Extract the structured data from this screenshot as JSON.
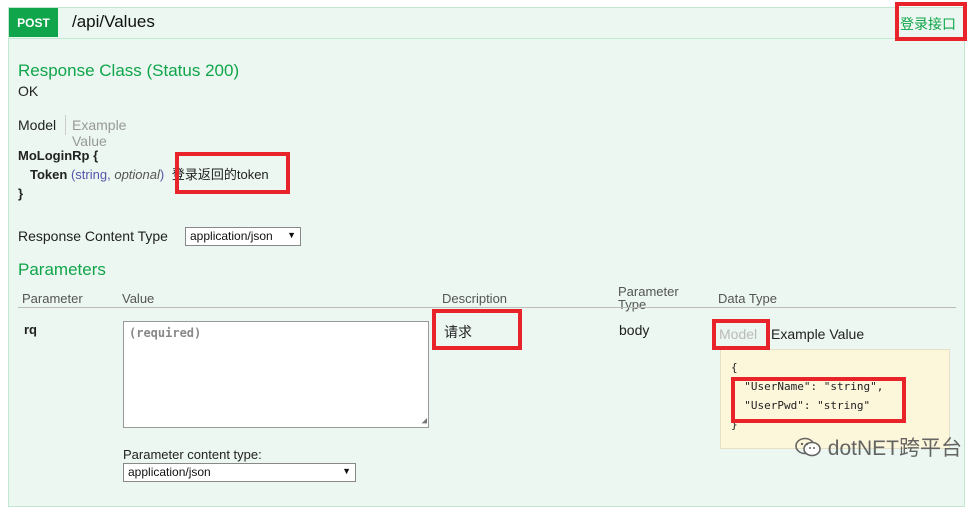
{
  "operation": {
    "method": "POST",
    "path": "/api/Values",
    "summary": "登录接口"
  },
  "response_class": {
    "heading": "Response Class (Status 200)",
    "status_text": "OK",
    "tabs": {
      "model": "Model",
      "example": "Example Value"
    },
    "model": {
      "name": "MoLoginRp",
      "open_brace": "{",
      "close_brace": "}",
      "property": {
        "name": "Token",
        "type_open": "(",
        "type": "string",
        "separator": ",",
        "optional": "optional",
        "type_close": ")",
        "description": "登录返回的token"
      }
    }
  },
  "response_content_type": {
    "label": "Response Content Type",
    "selected": "application/json"
  },
  "parameters": {
    "heading": "Parameters",
    "columns": {
      "parameter": "Parameter",
      "value": "Value",
      "description": "Description",
      "parameter_type_line1": "Parameter",
      "parameter_type_line2": "Type",
      "data_type": "Data Type"
    },
    "rows": [
      {
        "name": "rq",
        "value_placeholder": "(required)",
        "description": "请求",
        "parameter_type": "body",
        "data_type_tabs": {
          "model": "Model",
          "example": "Example Value"
        },
        "example_lines": [
          "{",
          "  \"UserName\": \"string\",",
          "  \"UserPwd\": \"string\"",
          "}"
        ],
        "content_type_label": "Parameter content type:",
        "content_type_selected": "application/json"
      }
    ]
  },
  "watermark": {
    "text": "dotNET跨平台"
  },
  "colors": {
    "accent_green": "#10a54a",
    "panel_bg": "#ebf7f0",
    "highlight_red": "#e8232a",
    "sample_bg": "#fcf6db"
  }
}
